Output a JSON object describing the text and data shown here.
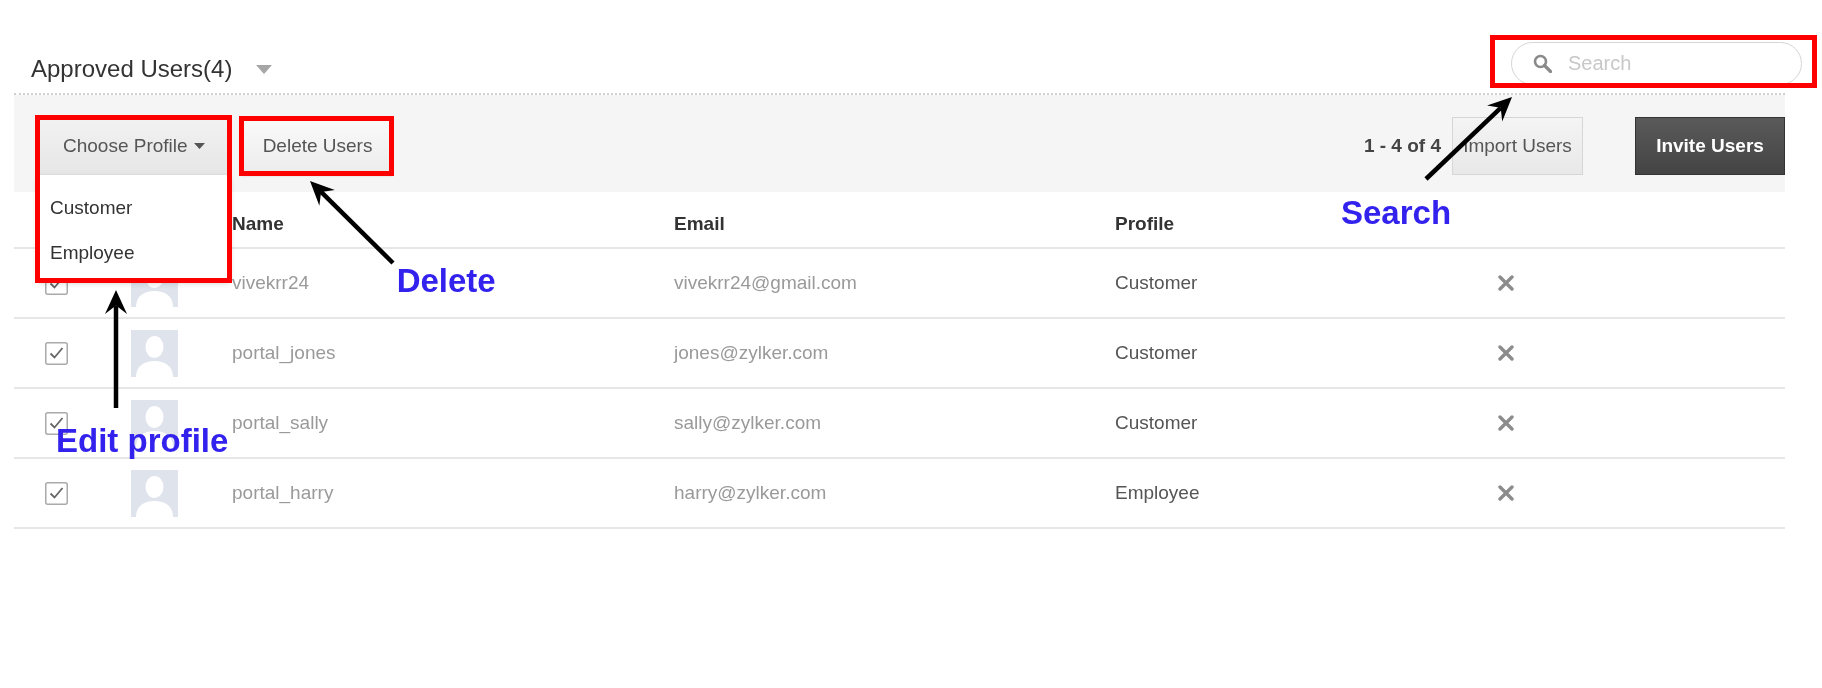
{
  "header": {
    "title": "Approved Users(4)",
    "search": {
      "placeholder": "Search"
    }
  },
  "toolbar": {
    "profile_menu": {
      "label": "Choose Profile",
      "expanded": true,
      "options": [
        "Customer",
        "Employee"
      ]
    },
    "delete_button": "Delete Users",
    "range": "1 - 4 of 4",
    "import_button": "Import Users",
    "invite_button": "Invite Users"
  },
  "table": {
    "columns": [
      "Name",
      "Email",
      "Profile"
    ],
    "rows": [
      {
        "checked": true,
        "name": "vivekrr24",
        "email": "vivekrr24@gmail.com",
        "profile": "Customer"
      },
      {
        "checked": true,
        "name": "portal_jones",
        "email": "jones@zylker.com",
        "profile": "Customer"
      },
      {
        "checked": true,
        "name": "portal_sally",
        "email": "sally@zylker.com",
        "profile": "Customer"
      },
      {
        "checked": true,
        "name": "portal_harry",
        "email": "harry@zylker.com",
        "profile": "Employee"
      }
    ]
  },
  "annotations": [
    {
      "kind": "search",
      "label": "Search"
    },
    {
      "kind": "delete",
      "label": "Delete"
    },
    {
      "kind": "profile",
      "label": "Edit profile"
    }
  ]
}
